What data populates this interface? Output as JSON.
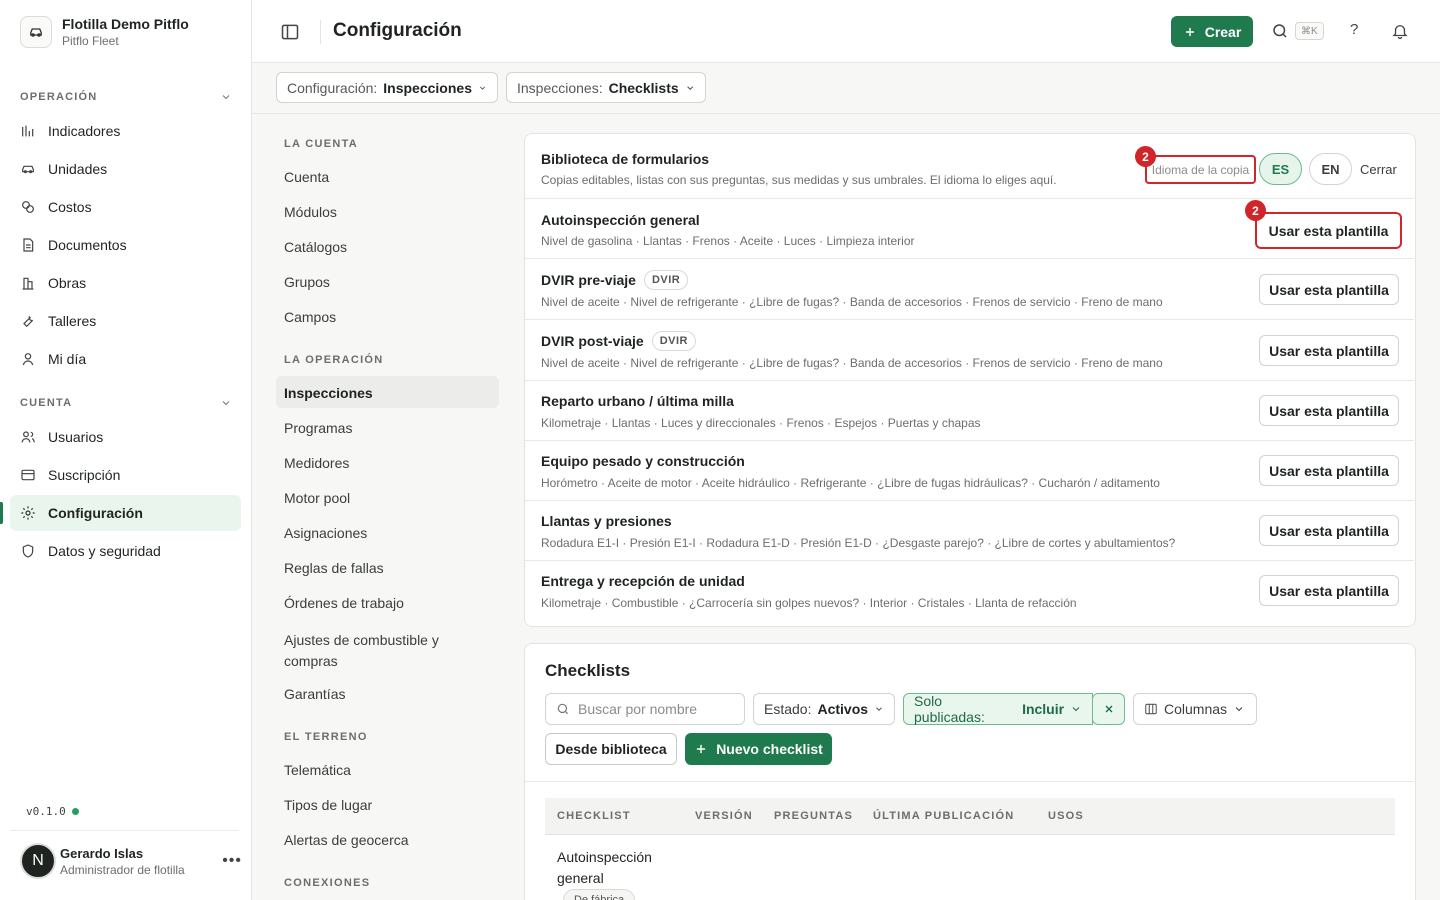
{
  "org": {
    "name": "Flotilla Demo Pitflo",
    "subtitle": "Pitflo Fleet"
  },
  "sidebar": {
    "sections": [
      {
        "label": "OPERACIÓN",
        "items": [
          {
            "label": "Indicadores",
            "icon": "chart-icon"
          },
          {
            "label": "Unidades",
            "icon": "car-icon"
          },
          {
            "label": "Costos",
            "icon": "coins-icon"
          },
          {
            "label": "Documentos",
            "icon": "document-icon"
          },
          {
            "label": "Obras",
            "icon": "building-icon"
          },
          {
            "label": "Talleres",
            "icon": "wrench-icon"
          },
          {
            "label": "Mi día",
            "icon": "person-icon"
          }
        ]
      },
      {
        "label": "CUENTA",
        "items": [
          {
            "label": "Usuarios",
            "icon": "users-icon"
          },
          {
            "label": "Suscripción",
            "icon": "card-icon"
          },
          {
            "label": "Configuración",
            "icon": "gear-icon",
            "active": true
          },
          {
            "label": "Datos y seguridad",
            "icon": "shield-icon"
          }
        ]
      }
    ],
    "version": "v0.1.0",
    "user": {
      "initial": "N",
      "name": "Gerardo Islas",
      "role": "Administrador de flotilla",
      "more": "•••"
    }
  },
  "topbar": {
    "title": "Configuración",
    "create_label": "Crear",
    "kbd": "⌘K",
    "help": "?"
  },
  "subbar": {
    "crumb1_label": "Configuración:",
    "crumb1_value": "Inspecciones",
    "crumb2_label": "Inspecciones:",
    "crumb2_value": "Checklists"
  },
  "settings_nav": {
    "groups": [
      {
        "label": "LA CUENTA",
        "items": [
          "Cuenta",
          "Módulos",
          "Catálogos",
          "Grupos",
          "Campos"
        ]
      },
      {
        "label": "LA OPERACIÓN",
        "items": [
          "Inspecciones",
          "Programas",
          "Medidores",
          "Motor pool",
          "Asignaciones",
          "Reglas de fallas",
          "Órdenes de trabajo",
          "Ajustes de combustible y compras",
          "Garantías"
        ]
      },
      {
        "label": "EL TERRENO",
        "items": [
          "Telemática",
          "Tipos de lugar",
          "Alertas de geocerca"
        ]
      },
      {
        "label": "CONEXIONES",
        "items": []
      }
    ],
    "active": "Inspecciones"
  },
  "library": {
    "title": "Biblioteca de formularios",
    "subtitle": "Copias editables, listas con sus preguntas, sus medidas y sus umbrales. El idioma lo eliges aquí.",
    "lang_label": "Idioma de la copia",
    "badge_lang": "2",
    "badge_btn": "2",
    "lang_es": "ES",
    "lang_en": "EN",
    "close": "Cerrar",
    "use_label": "Usar esta plantilla",
    "templates": [
      {
        "name": "Autoinspección general",
        "tag": "",
        "desc": "Nivel de gasolina · Llantas · Frenos · Aceite · Luces · Limpieza interior"
      },
      {
        "name": "DVIR pre-viaje",
        "tag": "DVIR",
        "desc": "Nivel de aceite · Nivel de refrigerante · ¿Libre de fugas? · Banda de accesorios · Frenos de servicio · Freno de mano"
      },
      {
        "name": "DVIR post-viaje",
        "tag": "DVIR",
        "desc": "Nivel de aceite · Nivel de refrigerante · ¿Libre de fugas? · Banda de accesorios · Frenos de servicio · Freno de mano"
      },
      {
        "name": "Reparto urbano / última milla",
        "tag": "",
        "desc": "Kilometraje · Llantas · Luces y direccionales · Frenos · Espejos · Puertas y chapas"
      },
      {
        "name": "Equipo pesado y construcción",
        "tag": "",
        "desc": "Horómetro · Aceite de motor · Aceite hidráulico · Refrigerante · ¿Libre de fugas hidráulicas? · Cucharón / aditamento"
      },
      {
        "name": "Llantas y presiones",
        "tag": "",
        "desc": "Rodadura E1-I · Presión E1-I · Rodadura E1-D · Presión E1-D · ¿Desgaste parejo? · ¿Libre de cortes y abultamientos?"
      },
      {
        "name": "Entrega y recepción de unidad",
        "tag": "",
        "desc": "Kilometraje · Combustible · ¿Carrocería sin golpes nuevos? · Interior · Cristales · Llanta de refacción"
      }
    ]
  },
  "checklists": {
    "title": "Checklists",
    "search_placeholder": "Buscar por nombre",
    "estado_label": "Estado:",
    "estado_value": "Activos",
    "published_label": "Solo publicadas:",
    "published_value": "Incluir",
    "columns_label": "Columnas",
    "from_library": "Desde biblioteca",
    "new_checklist": "Nuevo checklist",
    "columns": [
      "CHECKLIST",
      "VERSIÓN",
      "PREGUNTAS",
      "ÚLTIMA PUBLICACIÓN",
      "USOS"
    ],
    "rows": [
      {
        "name": "Autoinspección general",
        "tag": "De fábrica"
      }
    ]
  },
  "colors": {
    "accent": "#1f7a4d",
    "highlight": "#d0262a"
  }
}
